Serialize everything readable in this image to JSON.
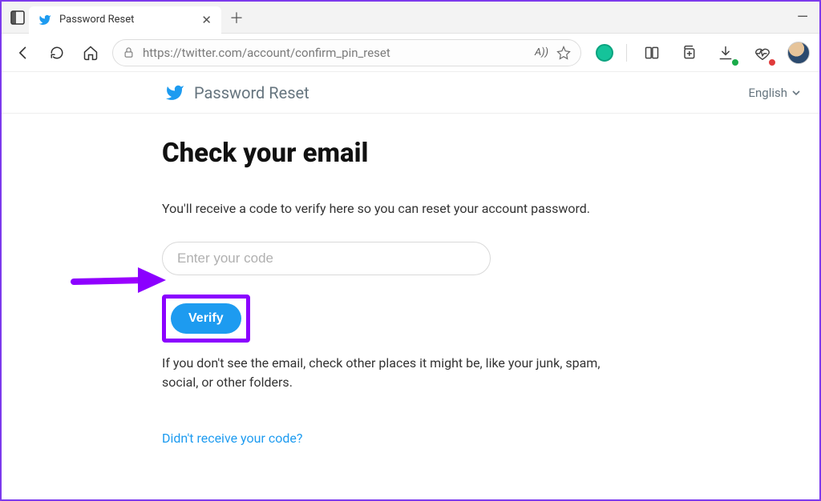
{
  "browser": {
    "tab_title": "Password Reset",
    "url": "https://twitter.com/account/confirm_pin_reset",
    "reader_label": "A))",
    "icons": {
      "sidebar": "tab-actions",
      "back": "←",
      "refresh": "↻",
      "home": "⌂",
      "lock": "🔒",
      "star": "☆",
      "split": "split-screen",
      "collections": "collections",
      "downloads": "downloads",
      "health": "heart-rate",
      "profile": "avatar"
    }
  },
  "page": {
    "brand_title": "Password Reset",
    "language_label": "English",
    "heading": "Check your email",
    "subtext": "You'll receive a code to verify here so you can reset your account password.",
    "code_placeholder": "Enter your code",
    "verify_label": "Verify",
    "note": "If you don't see the email, check other places it might be, like your junk, spam, social, or other folders.",
    "resend_link": "Didn't receive your code?"
  },
  "colors": {
    "accent": "#1d9bf0",
    "annotation": "#8b00ff"
  }
}
